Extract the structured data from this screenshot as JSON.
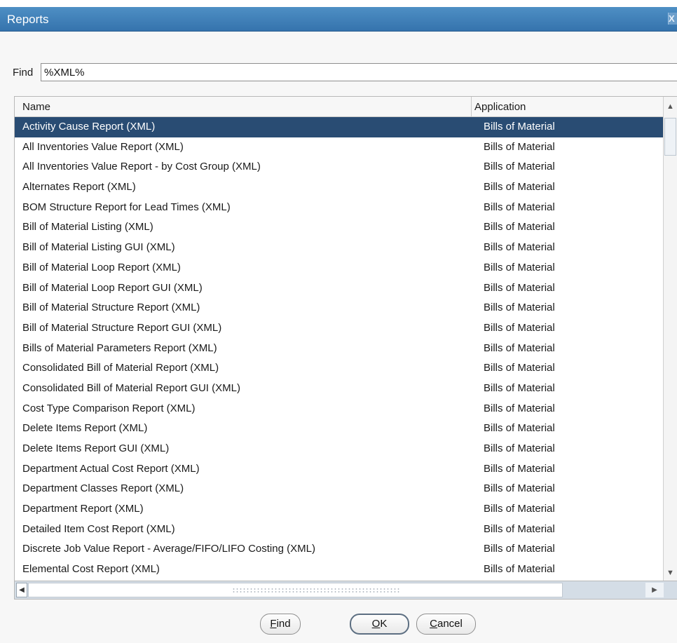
{
  "window": {
    "title": "Reports",
    "close_glyph": "X"
  },
  "find": {
    "label": "Find",
    "value": "%XML%"
  },
  "table": {
    "columns": [
      "Name",
      "Application"
    ],
    "selected_index": 0,
    "rows": [
      {
        "name": "Activity Cause Report (XML)",
        "application": "Bills of Material"
      },
      {
        "name": "All Inventories Value Report (XML)",
        "application": "Bills of Material"
      },
      {
        "name": "All Inventories Value Report - by Cost Group (XML)",
        "application": "Bills of Material"
      },
      {
        "name": "Alternates Report (XML)",
        "application": "Bills of Material"
      },
      {
        "name": "BOM Structure Report for Lead Times (XML)",
        "application": "Bills of Material"
      },
      {
        "name": "Bill of Material Listing (XML)",
        "application": "Bills of Material"
      },
      {
        "name": "Bill of Material Listing GUI (XML)",
        "application": "Bills of Material"
      },
      {
        "name": "Bill of Material Loop Report (XML)",
        "application": "Bills of Material"
      },
      {
        "name": "Bill of Material Loop Report GUI (XML)",
        "application": "Bills of Material"
      },
      {
        "name": "Bill of Material Structure Report (XML)",
        "application": "Bills of Material"
      },
      {
        "name": "Bill of Material Structure Report GUI (XML)",
        "application": "Bills of Material"
      },
      {
        "name": "Bills of Material Parameters Report (XML)",
        "application": "Bills of Material"
      },
      {
        "name": "Consolidated Bill of Material Report (XML)",
        "application": "Bills of Material"
      },
      {
        "name": "Consolidated Bill of Material Report GUI (XML)",
        "application": "Bills of Material"
      },
      {
        "name": "Cost Type Comparison Report (XML)",
        "application": "Bills of Material"
      },
      {
        "name": "Delete Items Report (XML)",
        "application": "Bills of Material"
      },
      {
        "name": "Delete Items Report GUI (XML)",
        "application": "Bills of Material"
      },
      {
        "name": "Department Actual Cost Report (XML)",
        "application": "Bills of Material"
      },
      {
        "name": "Department Classes Report (XML)",
        "application": "Bills of Material"
      },
      {
        "name": "Department Report (XML)",
        "application": "Bills of Material"
      },
      {
        "name": "Detailed Item Cost Report (XML)",
        "application": "Bills of Material"
      },
      {
        "name": "Discrete Job Value Report - Average/FIFO/LIFO Costing (XML)",
        "application": "Bills of Material"
      },
      {
        "name": "Elemental Cost Report (XML)",
        "application": "Bills of Material"
      }
    ]
  },
  "buttons": {
    "find": {
      "mnemonic": "F",
      "rest": "ind"
    },
    "ok": {
      "mnemonic": "O",
      "rest": "K"
    },
    "cancel": {
      "mnemonic": "C",
      "rest": "ancel"
    }
  },
  "colors": {
    "titlebar": "#3f7fb8",
    "selection": "#294c73"
  }
}
